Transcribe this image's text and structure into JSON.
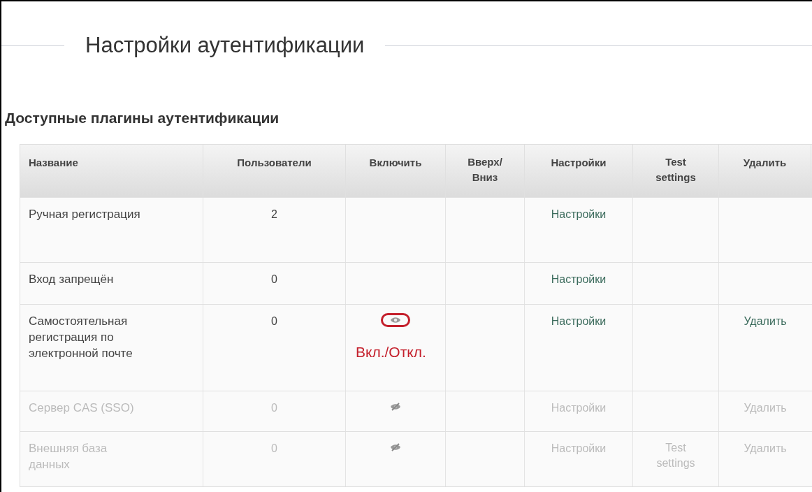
{
  "page_title": "Настройки аутентификации",
  "section_title": "Доступные плагины аутентификации",
  "table": {
    "columns": [
      "Название",
      "Пользователи",
      "Включить",
      "Вверх/ Вниз",
      "Настройки",
      "Test settings",
      "Удалить"
    ],
    "rows": [
      {
        "name": "Ручная регистрация",
        "users": "2",
        "enabled": true,
        "settings": "Настройки"
      },
      {
        "name": "Вход запрещён",
        "users": "0",
        "enabled": true,
        "settings": "Настройки"
      },
      {
        "name": "Самостоятельная регистрация по электронной почте",
        "users": "0",
        "enabled": true,
        "toggle": {
          "kind": "eye",
          "highlighted": true,
          "annotation": "Вкл./Откл."
        },
        "settings": "Настройки",
        "delete": "Удалить"
      },
      {
        "name": "Сервер CAS (SSO)",
        "users": "0",
        "enabled": false,
        "toggle": {
          "kind": "eye-off",
          "highlighted": false
        },
        "settings": "Настройки",
        "delete": "Удалить"
      },
      {
        "name": "Внешняя база данных",
        "users": "0",
        "enabled": false,
        "toggle": {
          "kind": "eye-off",
          "highlighted": false
        },
        "settings": "Настройки",
        "test": "Test settings",
        "delete": "Удалить"
      }
    ]
  }
}
